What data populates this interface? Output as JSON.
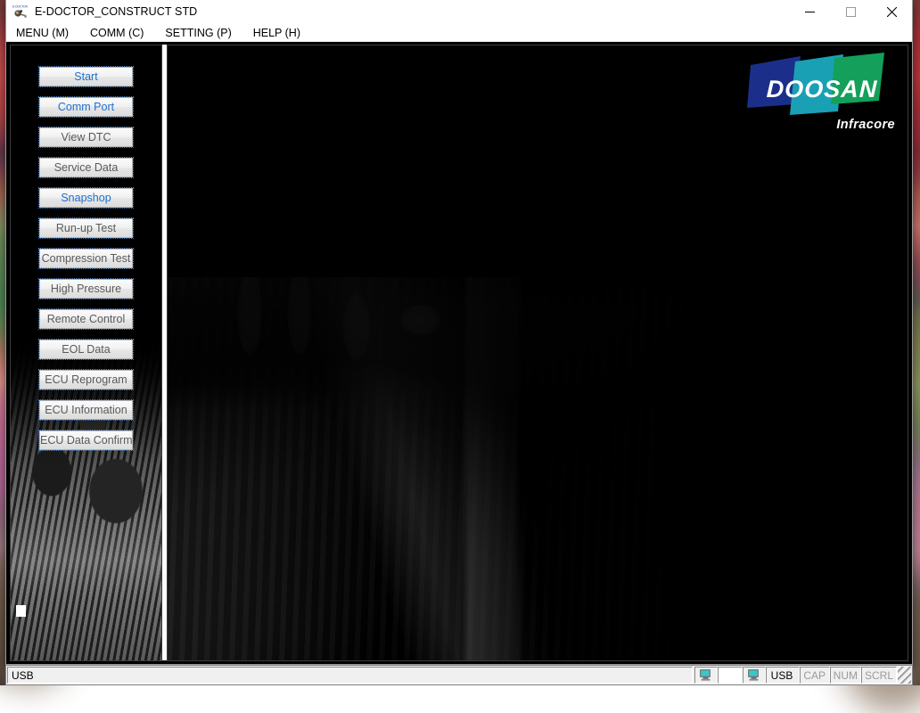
{
  "window": {
    "title": "E-DOCTOR_CONSTRUCT STD",
    "app_icon": "e-doctor-device-icon",
    "minimize_label": "–",
    "maximize_label": "□",
    "close_label": "✕"
  },
  "menu_bar": {
    "items": [
      {
        "label": "MENU (M)",
        "name": "menu"
      },
      {
        "label": "COMM (C)",
        "name": "comm"
      },
      {
        "label": "SETTING (P)",
        "name": "setting"
      },
      {
        "label": "HELP (H)",
        "name": "help"
      }
    ]
  },
  "sidebar": {
    "buttons": [
      {
        "label": "Start",
        "enabled": true
      },
      {
        "label": "Comm Port",
        "enabled": true
      },
      {
        "label": "View DTC",
        "enabled": false
      },
      {
        "label": "Service Data",
        "enabled": false
      },
      {
        "label": "Snapshop",
        "enabled": true
      },
      {
        "label": "Run-up Test",
        "enabled": false
      },
      {
        "label": "Compression Test",
        "enabled": false
      },
      {
        "label": "High Pressure",
        "enabled": false
      },
      {
        "label": "Remote Control",
        "enabled": false
      },
      {
        "label": "EOL Data",
        "enabled": false
      },
      {
        "label": "ECU Reprogram",
        "enabled": false
      },
      {
        "label": "ECU Information",
        "enabled": false
      },
      {
        "label": "ECU Data Confirm",
        "enabled": false
      }
    ]
  },
  "main_panel": {
    "logo": {
      "wordmark": "DOOSAN",
      "subtitle": "Infracore",
      "colors": {
        "blue": "#1b2f8a",
        "teal": "#1aa0b4",
        "green": "#14a05a",
        "text": "#ffffff"
      }
    },
    "background_image": "diesel-engine-photo"
  },
  "status_bar": {
    "message": "USB",
    "connection_label": "USB",
    "indicators": [
      "CAP",
      "NUM",
      "SCRL"
    ],
    "icons": [
      "computer-icon",
      "computer-icon"
    ]
  },
  "colors": {
    "enabled_button_text": "#1f6fd0",
    "disabled_button_text": "#5a5a5a",
    "window_background": "#000000",
    "titlebar_background": "#ffffff",
    "statusbar_background": "#f0f0f0"
  }
}
